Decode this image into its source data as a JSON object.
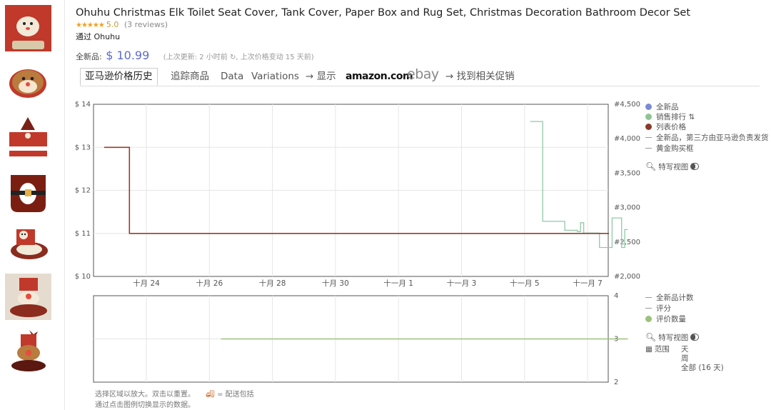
{
  "product": {
    "title": "Ohuhu Christmas Elk Toilet Seat Cover, Tank Cover, Paper Box and Rug Set, Christmas Decoration Bathroom Decor Set",
    "stars": "★★★★★",
    "rating": "5.0",
    "reviews": "(3 reviews)",
    "by": "通过 Ohuhu"
  },
  "price": {
    "label": "全新品:",
    "value": "$ 10.99",
    "updated": "(上次更新:  2 小时前 ↻, 上次价格变动 15 天前)"
  },
  "tabs": {
    "history": "亚马逊价格历史",
    "track": "追踪商品",
    "data": "Data",
    "variations": "Variations",
    "show": "→ 显示",
    "amazon": "amazon.com",
    "ebay": "ebay",
    "deals": "→ 找到相关促销"
  },
  "legend_top": {
    "new": "全新品",
    "sales_rank": "销售排行",
    "list_price": "列表价格",
    "third_party": "全新品，第三方由亚马逊负责发货",
    "buybox": "黄金购买框",
    "close_up": "特写视图"
  },
  "legend_bottom": {
    "new_count": "全新品计数",
    "rating": "评分",
    "review_count": "评价数量",
    "close_up": "特写视图",
    "range_label": "范围",
    "range_day": "天",
    "range_week": "周",
    "range_all": "全部 (16 天)"
  },
  "footer": {
    "zoom_hint": "选择区域以放大。双击以重置。",
    "shipping": "= 配送包括",
    "legend_hint": "通过点击图例切换显示的数据。"
  },
  "colors": {
    "new": "#7a8bd6",
    "sales_rank": "#8fc493",
    "list_price": "#8b3a2a",
    "rating": "#9ac27b",
    "line_red": "#9b3a2c",
    "line_green": "#8fc9a8"
  },
  "icons": [
    "search-icon",
    "calendar-icon",
    "truck-icon",
    "sort-icon",
    "refresh-icon",
    "toggle-icon"
  ],
  "chart_data": [
    {
      "type": "line",
      "x_tick_labels": [
        "十月 24",
        "十月 26",
        "十月 28",
        "十月 30",
        "十一月 1",
        "十一月 3",
        "十一月 5",
        "十一月 7"
      ],
      "y_left_ticks": [
        "$ 14",
        "$ 13",
        "$ 12",
        "$ 11",
        "$ 10"
      ],
      "y_right_ticks": [
        "#4,500",
        "#4,000",
        "#3,500",
        "#3,000",
        "#2,500",
        "#2,000"
      ],
      "ylim_left": [
        10,
        14
      ],
      "ylim_right": [
        2000,
        4500
      ],
      "x_range_days": [
        0,
        16
      ],
      "grid": true,
      "legend_position": "right",
      "series": [
        {
          "name": "列表价格",
          "axis": "left",
          "step": true,
          "points": [
            [
              0,
              13
            ],
            [
              0.8,
              13
            ],
            [
              0.8,
              11
            ],
            [
              16,
              11
            ]
          ]
        },
        {
          "name": "销售排行",
          "axis": "right",
          "step": true,
          "points": [
            [
              13.5,
              4250
            ],
            [
              13.9,
              4250
            ],
            [
              13.9,
              2800
            ],
            [
              14.6,
              2800
            ],
            [
              14.6,
              2670
            ],
            [
              15.0,
              2670
            ],
            [
              15.0,
              2650
            ],
            [
              15.1,
              2650
            ],
            [
              15.1,
              2780
            ],
            [
              15.2,
              2780
            ],
            [
              15.2,
              2630
            ],
            [
              15.7,
              2630
            ],
            [
              15.7,
              2420
            ],
            [
              16.1,
              2420
            ],
            [
              16.1,
              2850
            ],
            [
              16.4,
              2850
            ],
            [
              16.4,
              2420
            ],
            [
              16.5,
              2420
            ],
            [
              16.5,
              2680
            ],
            [
              16.6,
              2680
            ]
          ]
        }
      ]
    },
    {
      "type": "line",
      "y_right_ticks": [
        "4",
        "3",
        "2"
      ],
      "ylim_right": [
        2,
        4
      ],
      "grid": true,
      "legend_position": "right",
      "series": [
        {
          "name": "评价数量",
          "axis": "right",
          "points": [
            [
              3.7,
              3
            ],
            [
              16.6,
              3
            ]
          ]
        }
      ]
    }
  ]
}
